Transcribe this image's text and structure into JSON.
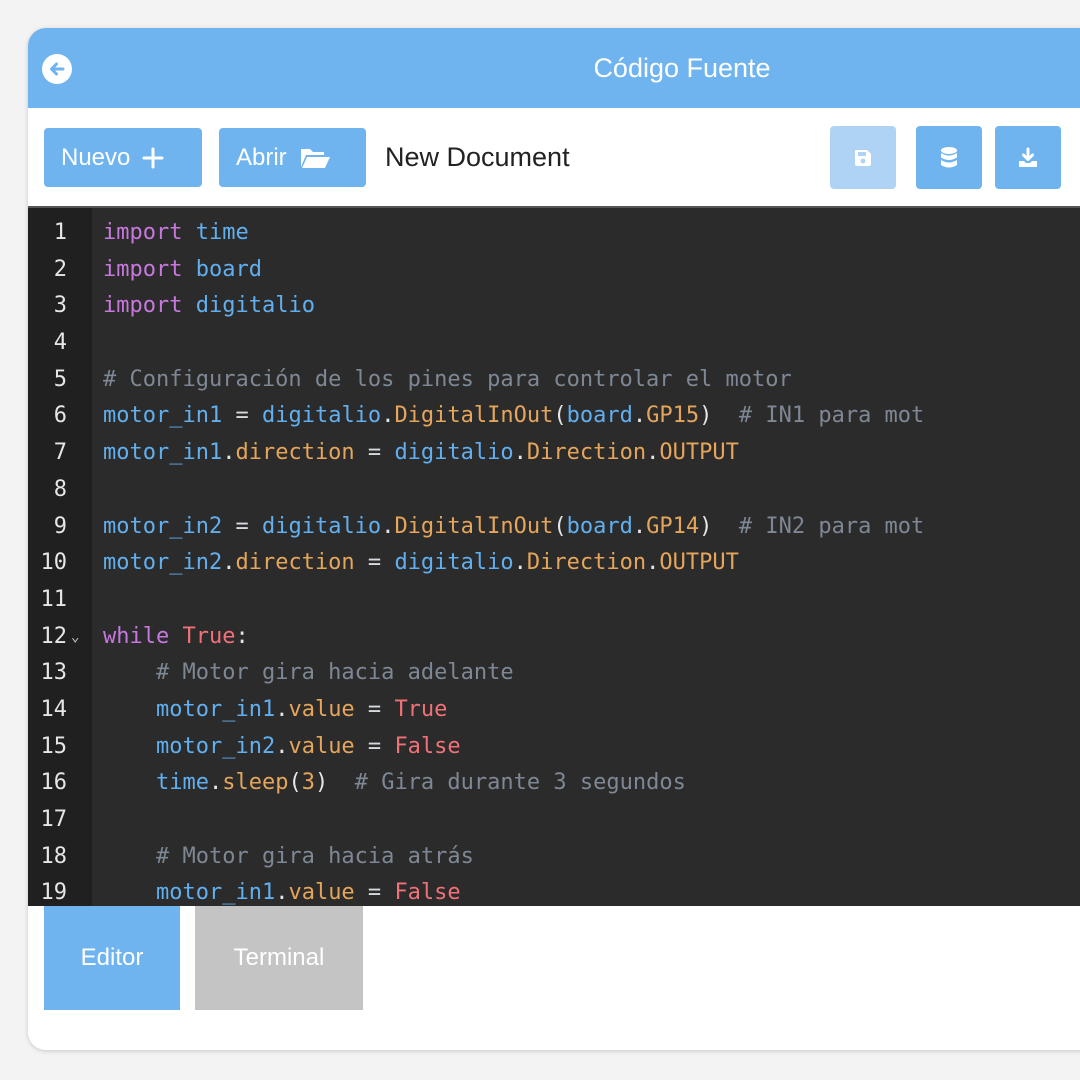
{
  "header": {
    "title": "Código Fuente",
    "back_icon": "arrow-left-circle-icon"
  },
  "toolbar": {
    "new_label": "Nuevo",
    "new_icon": "plus-icon",
    "open_label": "Abrir",
    "open_icon": "folder-open-icon",
    "document_name": "New Document",
    "save_icon": "save-icon",
    "save_disabled": true,
    "database_icon": "database-icon",
    "download_icon": "download-icon"
  },
  "editor": {
    "lines": [
      {
        "n": "1",
        "tokens": [
          [
            "kw",
            "import"
          ],
          [
            "pn",
            " "
          ],
          [
            "mod",
            "time"
          ]
        ]
      },
      {
        "n": "2",
        "tokens": [
          [
            "kw",
            "import"
          ],
          [
            "pn",
            " "
          ],
          [
            "mod",
            "board"
          ]
        ]
      },
      {
        "n": "3",
        "tokens": [
          [
            "kw",
            "import"
          ],
          [
            "pn",
            " "
          ],
          [
            "mod",
            "digitalio"
          ]
        ]
      },
      {
        "n": "4",
        "tokens": []
      },
      {
        "n": "5",
        "tokens": [
          [
            "cm",
            "# Configuración de los pines para controlar el motor"
          ]
        ]
      },
      {
        "n": "6",
        "tokens": [
          [
            "var",
            "motor_in1"
          ],
          [
            "op",
            " = "
          ],
          [
            "var",
            "digitalio"
          ],
          [
            "pn",
            "."
          ],
          [
            "attr",
            "DigitalInOut"
          ],
          [
            "pn",
            "("
          ],
          [
            "var",
            "board"
          ],
          [
            "pn",
            "."
          ],
          [
            "attr",
            "GP15"
          ],
          [
            "pn",
            ")  "
          ],
          [
            "cm",
            "# IN1 para mot"
          ]
        ]
      },
      {
        "n": "7",
        "tokens": [
          [
            "var",
            "motor_in1"
          ],
          [
            "pn",
            "."
          ],
          [
            "attr",
            "direction"
          ],
          [
            "op",
            " = "
          ],
          [
            "var",
            "digitalio"
          ],
          [
            "pn",
            "."
          ],
          [
            "attr",
            "Direction"
          ],
          [
            "pn",
            "."
          ],
          [
            "attr",
            "OUTPUT"
          ]
        ]
      },
      {
        "n": "8",
        "tokens": []
      },
      {
        "n": "9",
        "tokens": [
          [
            "var",
            "motor_in2"
          ],
          [
            "op",
            " = "
          ],
          [
            "var",
            "digitalio"
          ],
          [
            "pn",
            "."
          ],
          [
            "attr",
            "DigitalInOut"
          ],
          [
            "pn",
            "("
          ],
          [
            "var",
            "board"
          ],
          [
            "pn",
            "."
          ],
          [
            "attr",
            "GP14"
          ],
          [
            "pn",
            ")  "
          ],
          [
            "cm",
            "# IN2 para mot"
          ]
        ]
      },
      {
        "n": "10",
        "tokens": [
          [
            "var",
            "motor_in2"
          ],
          [
            "pn",
            "."
          ],
          [
            "attr",
            "direction"
          ],
          [
            "op",
            " = "
          ],
          [
            "var",
            "digitalio"
          ],
          [
            "pn",
            "."
          ],
          [
            "attr",
            "Direction"
          ],
          [
            "pn",
            "."
          ],
          [
            "attr",
            "OUTPUT"
          ]
        ]
      },
      {
        "n": "11",
        "tokens": []
      },
      {
        "n": "12",
        "fold": true,
        "tokens": [
          [
            "kw",
            "while"
          ],
          [
            "pn",
            " "
          ],
          [
            "bool",
            "True"
          ],
          [
            "pn",
            ":"
          ]
        ]
      },
      {
        "n": "13",
        "tokens": [
          [
            "pn",
            "    "
          ],
          [
            "cm",
            "# Motor gira hacia adelante"
          ]
        ]
      },
      {
        "n": "14",
        "tokens": [
          [
            "pn",
            "    "
          ],
          [
            "var",
            "motor_in1"
          ],
          [
            "pn",
            "."
          ],
          [
            "attr",
            "value"
          ],
          [
            "op",
            " = "
          ],
          [
            "bool",
            "True"
          ]
        ]
      },
      {
        "n": "15",
        "tokens": [
          [
            "pn",
            "    "
          ],
          [
            "var",
            "motor_in2"
          ],
          [
            "pn",
            "."
          ],
          [
            "attr",
            "value"
          ],
          [
            "op",
            " = "
          ],
          [
            "bool",
            "False"
          ]
        ]
      },
      {
        "n": "16",
        "tokens": [
          [
            "pn",
            "    "
          ],
          [
            "var",
            "time"
          ],
          [
            "pn",
            "."
          ],
          [
            "attr",
            "sleep"
          ],
          [
            "pn",
            "("
          ],
          [
            "num",
            "3"
          ],
          [
            "pn",
            ")  "
          ],
          [
            "cm",
            "# Gira durante 3 segundos"
          ]
        ]
      },
      {
        "n": "17",
        "tokens": []
      },
      {
        "n": "18",
        "tokens": [
          [
            "pn",
            "    "
          ],
          [
            "cm",
            "# Motor gira hacia atrás"
          ]
        ]
      },
      {
        "n": "19",
        "tokens": [
          [
            "pn",
            "    "
          ],
          [
            "var",
            "motor_in1"
          ],
          [
            "pn",
            "."
          ],
          [
            "attr",
            "value"
          ],
          [
            "op",
            " = "
          ],
          [
            "bool",
            "False"
          ]
        ]
      }
    ]
  },
  "tabs": {
    "editor_label": "Editor",
    "terminal_label": "Terminal",
    "active": "Editor"
  },
  "colors": {
    "accent": "#6fb3ef",
    "accent_disabled": "#aed3f5",
    "editor_bg": "#2b2b2b",
    "gutter_bg": "#202020",
    "tab_inactive": "#c4c4c4"
  }
}
